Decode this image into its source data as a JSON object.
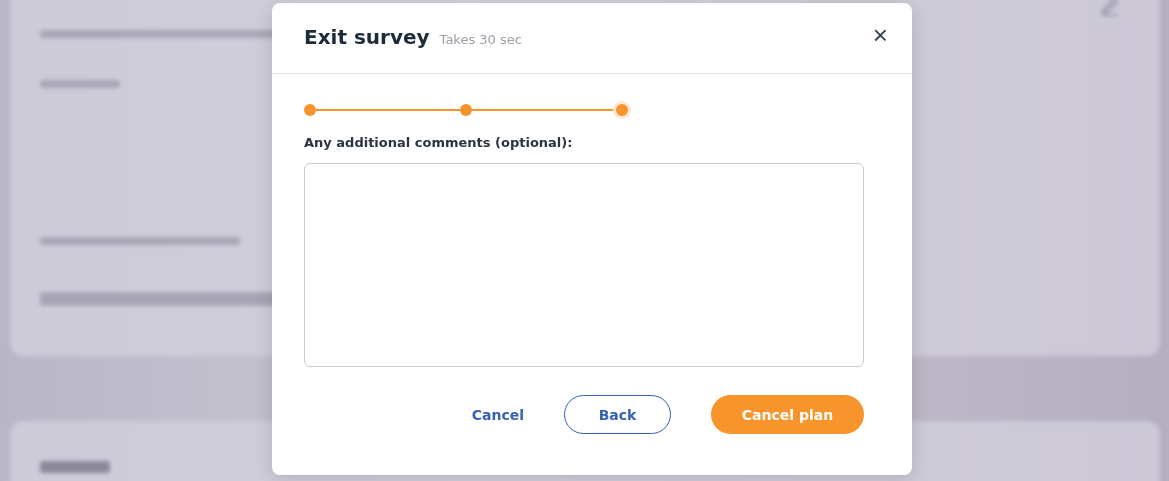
{
  "dialog": {
    "title": "Exit survey",
    "subtitle": "Takes 30 sec",
    "close": "×"
  },
  "steps": [
    {
      "done": true,
      "selected": false
    },
    {
      "done": true,
      "selected": false
    },
    {
      "done": true,
      "selected": true
    }
  ],
  "question": {
    "label": "Any additional comments (optional):"
  },
  "buttons": [
    {
      "kind": "link",
      "label": "Cancel"
    },
    {
      "kind": "outline",
      "label": "Back"
    },
    {
      "kind": "primary",
      "label": "Cancel plan"
    }
  ]
}
